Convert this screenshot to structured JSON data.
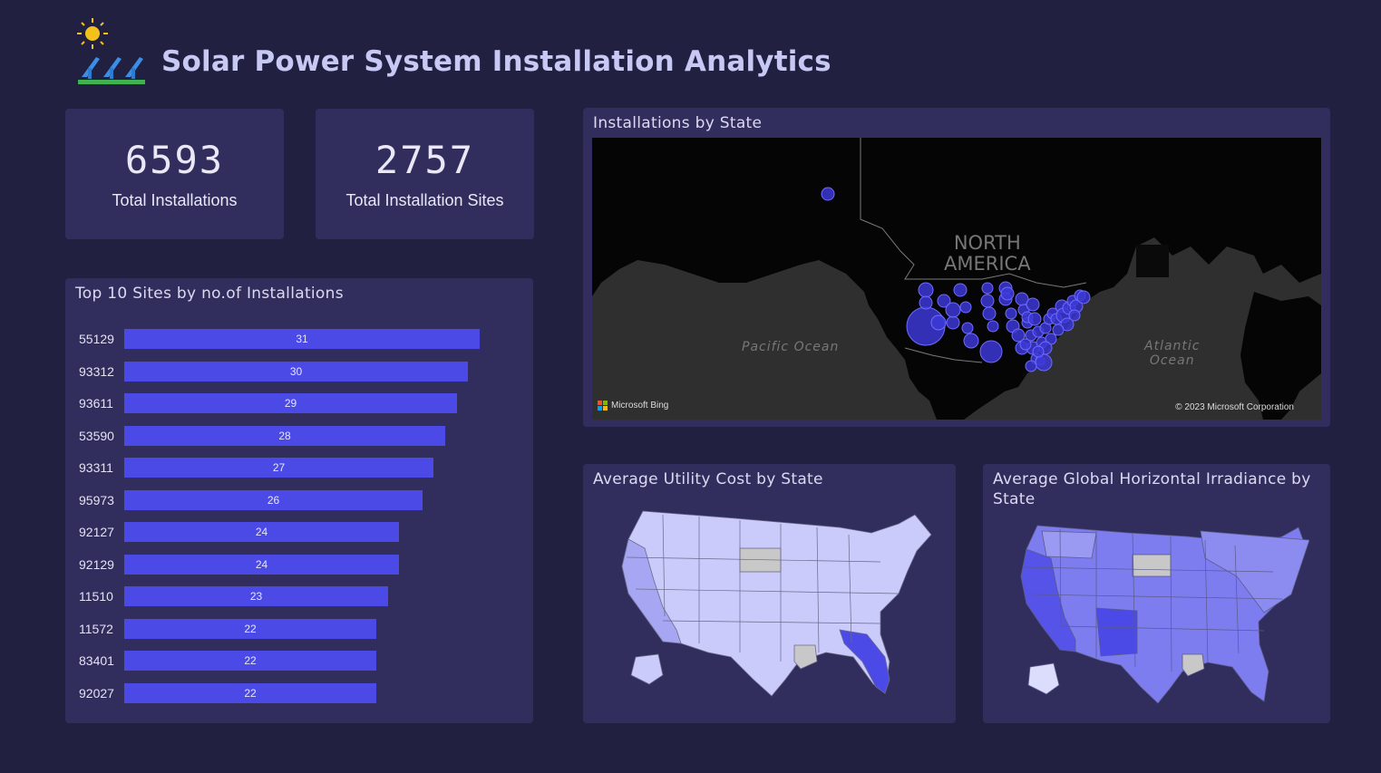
{
  "page": {
    "title": "Solar Power System Installation Analytics"
  },
  "kpis": [
    {
      "value": "6593",
      "label": "Total Installations"
    },
    {
      "value": "2757",
      "label": "Total Installation Sites"
    }
  ],
  "top_sites": {
    "title": "Top 10 Sites by no.of Installations",
    "chart_data": {
      "type": "bar",
      "orientation": "horizontal",
      "categories": [
        "55129",
        "93312",
        "93611",
        "53590",
        "93311",
        "95973",
        "92127",
        "92129",
        "11510",
        "11572",
        "83401",
        "92027"
      ],
      "values": [
        31,
        30,
        29,
        28,
        27,
        26,
        24,
        24,
        23,
        22,
        22,
        22
      ],
      "xlim": [
        0,
        31
      ]
    }
  },
  "installations_map": {
    "title": "Installations by State",
    "labels": {
      "continent": "NORTH\nAMERICA",
      "pacific": "Pacific Ocean",
      "atlantic": "Atlantic\nOcean",
      "brand": "Microsoft Bing",
      "copyright": "© 2023 Microsoft Corporation"
    },
    "colors": {
      "bubble": "#3d38d6",
      "bubble_stroke": "#6d6cff"
    }
  },
  "utility_map": {
    "title": "Average Utility Cost by State",
    "colors": {
      "low": "#c9c9fb",
      "mid": "#a3a3f4",
      "high": "#4b4ae6",
      "no_data": "#c8c8c8"
    }
  },
  "irradiance_map": {
    "title": "Average Global Horizontal Irradiance by State",
    "colors": {
      "low": "#d8d8fc",
      "mid": "#7b7bee",
      "high": "#4b4ae6",
      "no_data": "#c8c8c8"
    }
  }
}
